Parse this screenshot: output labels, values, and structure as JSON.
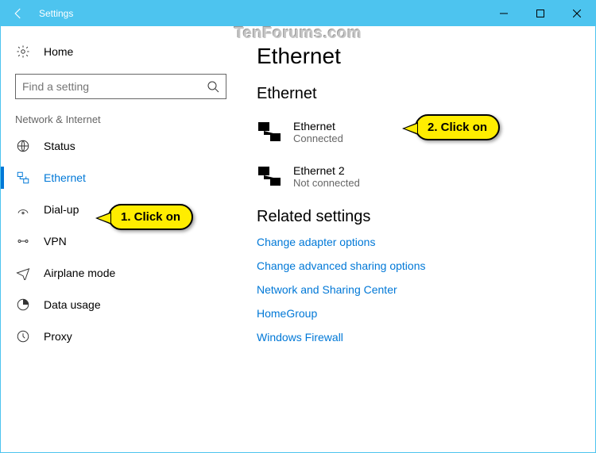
{
  "window": {
    "title": "Settings"
  },
  "watermark": "TenForums.com",
  "sidebar": {
    "home": "Home",
    "search_placeholder": "Find a setting",
    "section": "Network & Internet",
    "items": [
      {
        "label": "Status"
      },
      {
        "label": "Ethernet"
      },
      {
        "label": "Dial-up"
      },
      {
        "label": "VPN"
      },
      {
        "label": "Airplane mode"
      },
      {
        "label": "Data usage"
      },
      {
        "label": "Proxy"
      }
    ]
  },
  "main": {
    "title": "Ethernet",
    "subtitle": "Ethernet",
    "connections": [
      {
        "name": "Ethernet",
        "status": "Connected"
      },
      {
        "name": "Ethernet 2",
        "status": "Not connected"
      }
    ],
    "related_title": "Related settings",
    "links": [
      "Change adapter options",
      "Change advanced sharing options",
      "Network and Sharing Center",
      "HomeGroup",
      "Windows Firewall"
    ]
  },
  "callouts": {
    "c1": "1. Click on",
    "c2": "2. Click on"
  }
}
